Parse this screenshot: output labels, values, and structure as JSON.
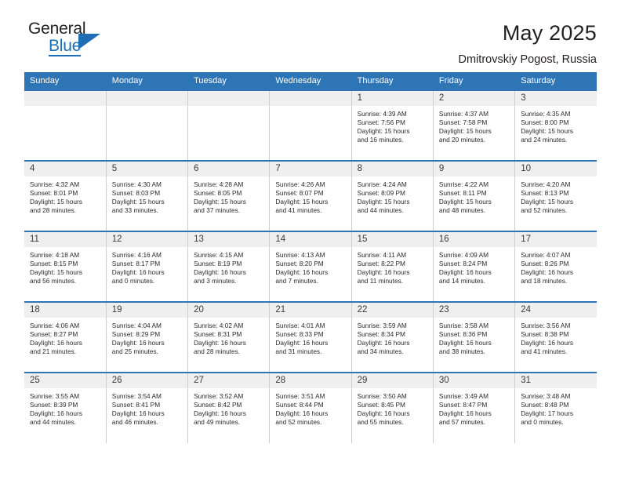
{
  "brand": {
    "name_top": "General",
    "name_bottom": "Blue",
    "triangle_color": "#1f6db5",
    "text_color": "#231f20"
  },
  "header": {
    "title": "May 2025",
    "subtitle": "Dmitrovskiy Pogost, Russia"
  },
  "theme": {
    "header_blue": "#2e75b6",
    "daynum_band": "#efefef",
    "text": "#2b2b2b"
  },
  "weekdays": [
    "Sunday",
    "Monday",
    "Tuesday",
    "Wednesday",
    "Thursday",
    "Friday",
    "Saturday"
  ],
  "weeks": [
    [
      {
        "day": "",
        "empty": true,
        "sunrise": "",
        "sunset": "",
        "daylight_1": "",
        "daylight_2": ""
      },
      {
        "day": "",
        "empty": true,
        "sunrise": "",
        "sunset": "",
        "daylight_1": "",
        "daylight_2": ""
      },
      {
        "day": "",
        "empty": true,
        "sunrise": "",
        "sunset": "",
        "daylight_1": "",
        "daylight_2": ""
      },
      {
        "day": "",
        "empty": true,
        "sunrise": "",
        "sunset": "",
        "daylight_1": "",
        "daylight_2": ""
      },
      {
        "day": "1",
        "sunrise": "Sunrise: 4:39 AM",
        "sunset": "Sunset: 7:56 PM",
        "daylight_1": "Daylight: 15 hours",
        "daylight_2": "and 16 minutes."
      },
      {
        "day": "2",
        "sunrise": "Sunrise: 4:37 AM",
        "sunset": "Sunset: 7:58 PM",
        "daylight_1": "Daylight: 15 hours",
        "daylight_2": "and 20 minutes."
      },
      {
        "day": "3",
        "sunrise": "Sunrise: 4:35 AM",
        "sunset": "Sunset: 8:00 PM",
        "daylight_1": "Daylight: 15 hours",
        "daylight_2": "and 24 minutes."
      }
    ],
    [
      {
        "day": "4",
        "sunrise": "Sunrise: 4:32 AM",
        "sunset": "Sunset: 8:01 PM",
        "daylight_1": "Daylight: 15 hours",
        "daylight_2": "and 28 minutes."
      },
      {
        "day": "5",
        "sunrise": "Sunrise: 4:30 AM",
        "sunset": "Sunset: 8:03 PM",
        "daylight_1": "Daylight: 15 hours",
        "daylight_2": "and 33 minutes."
      },
      {
        "day": "6",
        "sunrise": "Sunrise: 4:28 AM",
        "sunset": "Sunset: 8:05 PM",
        "daylight_1": "Daylight: 15 hours",
        "daylight_2": "and 37 minutes."
      },
      {
        "day": "7",
        "sunrise": "Sunrise: 4:26 AM",
        "sunset": "Sunset: 8:07 PM",
        "daylight_1": "Daylight: 15 hours",
        "daylight_2": "and 41 minutes."
      },
      {
        "day": "8",
        "sunrise": "Sunrise: 4:24 AM",
        "sunset": "Sunset: 8:09 PM",
        "daylight_1": "Daylight: 15 hours",
        "daylight_2": "and 44 minutes."
      },
      {
        "day": "9",
        "sunrise": "Sunrise: 4:22 AM",
        "sunset": "Sunset: 8:11 PM",
        "daylight_1": "Daylight: 15 hours",
        "daylight_2": "and 48 minutes."
      },
      {
        "day": "10",
        "sunrise": "Sunrise: 4:20 AM",
        "sunset": "Sunset: 8:13 PM",
        "daylight_1": "Daylight: 15 hours",
        "daylight_2": "and 52 minutes."
      }
    ],
    [
      {
        "day": "11",
        "sunrise": "Sunrise: 4:18 AM",
        "sunset": "Sunset: 8:15 PM",
        "daylight_1": "Daylight: 15 hours",
        "daylight_2": "and 56 minutes."
      },
      {
        "day": "12",
        "sunrise": "Sunrise: 4:16 AM",
        "sunset": "Sunset: 8:17 PM",
        "daylight_1": "Daylight: 16 hours",
        "daylight_2": "and 0 minutes."
      },
      {
        "day": "13",
        "sunrise": "Sunrise: 4:15 AM",
        "sunset": "Sunset: 8:19 PM",
        "daylight_1": "Daylight: 16 hours",
        "daylight_2": "and 3 minutes."
      },
      {
        "day": "14",
        "sunrise": "Sunrise: 4:13 AM",
        "sunset": "Sunset: 8:20 PM",
        "daylight_1": "Daylight: 16 hours",
        "daylight_2": "and 7 minutes."
      },
      {
        "day": "15",
        "sunrise": "Sunrise: 4:11 AM",
        "sunset": "Sunset: 8:22 PM",
        "daylight_1": "Daylight: 16 hours",
        "daylight_2": "and 11 minutes."
      },
      {
        "day": "16",
        "sunrise": "Sunrise: 4:09 AM",
        "sunset": "Sunset: 8:24 PM",
        "daylight_1": "Daylight: 16 hours",
        "daylight_2": "and 14 minutes."
      },
      {
        "day": "17",
        "sunrise": "Sunrise: 4:07 AM",
        "sunset": "Sunset: 8:26 PM",
        "daylight_1": "Daylight: 16 hours",
        "daylight_2": "and 18 minutes."
      }
    ],
    [
      {
        "day": "18",
        "sunrise": "Sunrise: 4:06 AM",
        "sunset": "Sunset: 8:27 PM",
        "daylight_1": "Daylight: 16 hours",
        "daylight_2": "and 21 minutes."
      },
      {
        "day": "19",
        "sunrise": "Sunrise: 4:04 AM",
        "sunset": "Sunset: 8:29 PM",
        "daylight_1": "Daylight: 16 hours",
        "daylight_2": "and 25 minutes."
      },
      {
        "day": "20",
        "sunrise": "Sunrise: 4:02 AM",
        "sunset": "Sunset: 8:31 PM",
        "daylight_1": "Daylight: 16 hours",
        "daylight_2": "and 28 minutes."
      },
      {
        "day": "21",
        "sunrise": "Sunrise: 4:01 AM",
        "sunset": "Sunset: 8:33 PM",
        "daylight_1": "Daylight: 16 hours",
        "daylight_2": "and 31 minutes."
      },
      {
        "day": "22",
        "sunrise": "Sunrise: 3:59 AM",
        "sunset": "Sunset: 8:34 PM",
        "daylight_1": "Daylight: 16 hours",
        "daylight_2": "and 34 minutes."
      },
      {
        "day": "23",
        "sunrise": "Sunrise: 3:58 AM",
        "sunset": "Sunset: 8:36 PM",
        "daylight_1": "Daylight: 16 hours",
        "daylight_2": "and 38 minutes."
      },
      {
        "day": "24",
        "sunrise": "Sunrise: 3:56 AM",
        "sunset": "Sunset: 8:38 PM",
        "daylight_1": "Daylight: 16 hours",
        "daylight_2": "and 41 minutes."
      }
    ],
    [
      {
        "day": "25",
        "sunrise": "Sunrise: 3:55 AM",
        "sunset": "Sunset: 8:39 PM",
        "daylight_1": "Daylight: 16 hours",
        "daylight_2": "and 44 minutes."
      },
      {
        "day": "26",
        "sunrise": "Sunrise: 3:54 AM",
        "sunset": "Sunset: 8:41 PM",
        "daylight_1": "Daylight: 16 hours",
        "daylight_2": "and 46 minutes."
      },
      {
        "day": "27",
        "sunrise": "Sunrise: 3:52 AM",
        "sunset": "Sunset: 8:42 PM",
        "daylight_1": "Daylight: 16 hours",
        "daylight_2": "and 49 minutes."
      },
      {
        "day": "28",
        "sunrise": "Sunrise: 3:51 AM",
        "sunset": "Sunset: 8:44 PM",
        "daylight_1": "Daylight: 16 hours",
        "daylight_2": "and 52 minutes."
      },
      {
        "day": "29",
        "sunrise": "Sunrise: 3:50 AM",
        "sunset": "Sunset: 8:45 PM",
        "daylight_1": "Daylight: 16 hours",
        "daylight_2": "and 55 minutes."
      },
      {
        "day": "30",
        "sunrise": "Sunrise: 3:49 AM",
        "sunset": "Sunset: 8:47 PM",
        "daylight_1": "Daylight: 16 hours",
        "daylight_2": "and 57 minutes."
      },
      {
        "day": "31",
        "sunrise": "Sunrise: 3:48 AM",
        "sunset": "Sunset: 8:48 PM",
        "daylight_1": "Daylight: 17 hours",
        "daylight_2": "and 0 minutes."
      }
    ]
  ]
}
